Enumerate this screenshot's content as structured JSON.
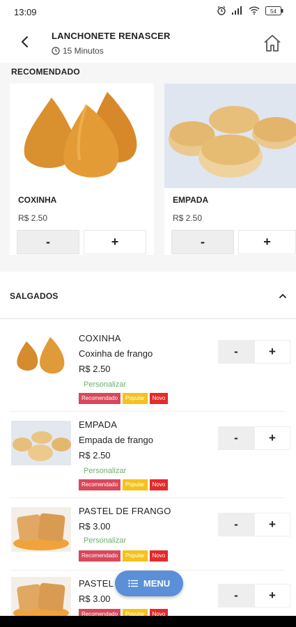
{
  "status": {
    "time": "13:09",
    "battery": "54"
  },
  "header": {
    "title": "LANCHONETE RENASCER",
    "subtitle": "15 Minutos"
  },
  "recommended": {
    "title": "RECOMENDADO",
    "items": [
      {
        "name": "COXINHA",
        "price": "R$ 2.50",
        "minus": "-",
        "plus": "+"
      },
      {
        "name": "EMPADA",
        "price": "R$ 2.50",
        "minus": "-",
        "plus": "+"
      }
    ]
  },
  "category": {
    "label": "SALGADOS"
  },
  "items": [
    {
      "name": "COXINHA",
      "desc": "Coxinha de frango",
      "price": "R$ 2.50",
      "custom": "Personalizar",
      "tags": [
        "Recomendado",
        "Popular",
        "Novo"
      ],
      "minus": "-",
      "plus": "+"
    },
    {
      "name": "EMPADA",
      "desc": "Empada de frango",
      "price": "R$ 2.50",
      "custom": "Personalizar",
      "tags": [
        "Recomendado",
        "Popular",
        "Novo"
      ],
      "minus": "-",
      "plus": "+"
    },
    {
      "name": "PASTEL DE FRANGO",
      "desc": "",
      "price": "R$ 3.00",
      "custom": "Personalizar",
      "tags": [
        "Recomendado",
        "Popular",
        "Novo"
      ],
      "minus": "-",
      "plus": "+"
    },
    {
      "name": "PASTEL",
      "desc": "",
      "price": "R$ 3.00",
      "custom": "",
      "tags": [
        "Recomendado",
        "Popular",
        "Novo"
      ],
      "minus": "-",
      "plus": "+"
    }
  ],
  "fab": {
    "label": "MENU"
  },
  "colors": {
    "accent": "#5b8fd8",
    "tag_recomendado": "#d9475a",
    "tag_popular": "#f4c21b",
    "tag_novo": "#e52a2a",
    "personalizar": "#6ab26a"
  }
}
